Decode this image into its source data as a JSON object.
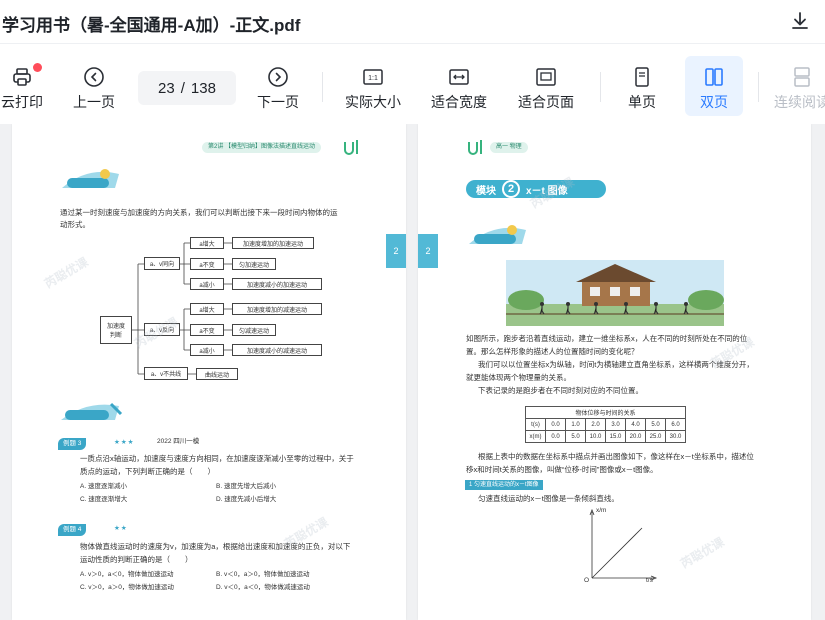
{
  "window": {
    "title": "学习用书（暑-全国通用-A加）-正文.pdf"
  },
  "toolbar": {
    "print": "云打印",
    "prev": "上一页",
    "current_page": "23",
    "page_sep": "/",
    "total_pages": "138",
    "next": "下一页",
    "actual_size": "实际大小",
    "fit_width": "适合宽度",
    "fit_page": "适合页面",
    "single": "单页",
    "double": "双页",
    "continuous": "连续阅读",
    "actual_size_icon_text": "1:1"
  },
  "left_page": {
    "header": "第2讲 【模型归纳】图像法描述直线运动",
    "intro1": "通过某一时刻速度与加速度的方向关系，我们可以判断出接下来一段时间内物体的运",
    "intro2": "动形式。",
    "root": "加速度\n判断",
    "branch1": "a、v同向",
    "branch2": "a、v反向",
    "branch3": "a、v不共线",
    "leaves": [
      "a增大",
      "a不变",
      "a减小",
      "a增大",
      "a不变",
      "a减小"
    ],
    "results": [
      "加速度增加的加速运动",
      "匀加速运动",
      "加速度减小的加速运动",
      "加速度增加的减速运动",
      "匀减速运动",
      "加速度减小的减速运动",
      "曲线运动"
    ],
    "ex3_tag": "例题 3",
    "ex3_stars": "★★★",
    "ex3_src": "2022 四川一模",
    "ex3_q1": "一质点沿x轴运动，加速度与速度方向相同，在加速度逐渐减小至零的过程中，关于",
    "ex3_q2": "质点的运动，下列判断正确的是（　　）",
    "ex3_a": "A. 速度逐渐减小",
    "ex3_b": "B. 速度先增大后减小",
    "ex3_c": "C. 速度逐渐增大",
    "ex3_d": "D. 速度先减小后增大",
    "ex4_tag": "例题 4",
    "ex4_stars": "★★",
    "ex4_q1": "物体做直线运动时的速度为v，加速度为a，根据给出速度和加速度的正负，对以下",
    "ex4_q2": "运动性质的判断正确的是（　　）",
    "ex4_a": "A. v＞0，a＜0，物体做加速运动",
    "ex4_b": "B. v＜0，a＞0，物体做加速运动",
    "ex4_c": "C. v＞0，a＞0，物体做加速运动",
    "ex4_d": "D. v＜0，a＜0，物体做减速运动",
    "side_num": "2"
  },
  "right_page": {
    "header": "高一 物理",
    "module": "模块",
    "module_num": "2",
    "module_name": "x－t 图像",
    "p1": "如图所示，跑步者沿着直线运动，建立一维坐标系x，人在不同的时刻所处在不同的位",
    "p2": "置。那么怎样形象的描述人的位置随时间的变化呢？",
    "p3": "我们可以以位置坐标x为纵轴，时间t为横轴建立直角坐标系，这样横两个维度分开，",
    "p4": "就更能体现两个物理量的关系。",
    "p5": "下表记录的是跑步者在不同时刻对应的不同位置。",
    "table_title": "物体位移与时间的关系",
    "row_t_label": "t(s)",
    "row_t": [
      "0.0",
      "1.0",
      "2.0",
      "3.0",
      "4.0",
      "5.0",
      "6.0"
    ],
    "row_x_label": "x(m)",
    "row_x": [
      "0.0",
      "5.0",
      "10.0",
      "15.0",
      "20.0",
      "25.0",
      "30.0"
    ],
    "p6": "根据上表中的数据在坐标系中描点并画出图像如下，像这样在x－t坐标系中，描述位",
    "p7": "移x和时间t关系的图像，叫做“位移-时间”图像或x－t图像。",
    "sec": "1 匀速直线运动的x－t图像",
    "p8": "匀速直线运动的x－t图像是一条倾斜直线。",
    "axis_y": "x/m",
    "axis_x": "t/s",
    "origin": "O",
    "side_num": "2"
  },
  "watermark": "芮聪优课"
}
